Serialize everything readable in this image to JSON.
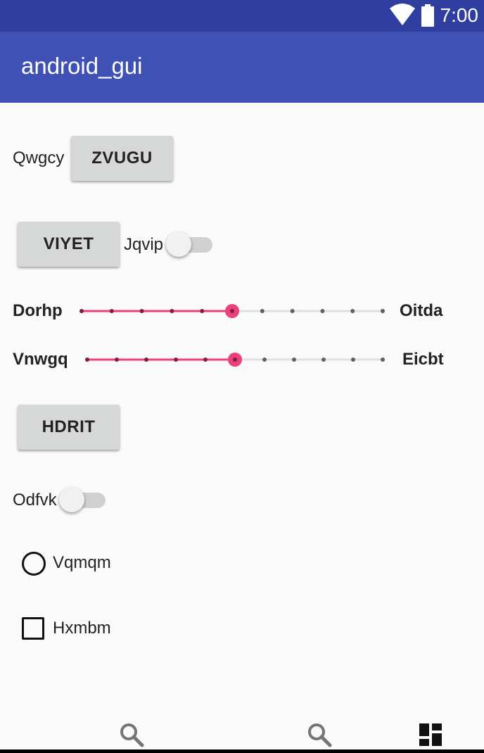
{
  "status_bar": {
    "time": "7:00",
    "icons": [
      "wifi-icon",
      "battery-icon"
    ]
  },
  "app_bar": {
    "title": "android_gui"
  },
  "row1": {
    "label": "Qwgcy",
    "button": "ZVUGU"
  },
  "row2": {
    "button": "VIYET",
    "switch_label": "Jqvip",
    "switch_on": false
  },
  "seekbar1": {
    "left_label": "Dorhp",
    "right_label": "Oitda",
    "steps": 10,
    "value": 5
  },
  "seekbar2": {
    "left_label": "Vnwgq",
    "right_label": "Eicbt",
    "steps": 10,
    "value": 5
  },
  "row3": {
    "button": "HDRIT"
  },
  "row4": {
    "switch_label": "Odfvk",
    "switch_on": false
  },
  "radio": {
    "label": "Vqmqm",
    "checked": false
  },
  "checkbox": {
    "label": "Hxmbm",
    "checked": false
  },
  "bottom_icons": [
    "search-icon",
    "search-icon",
    "dashboard-icon"
  ],
  "colors": {
    "primary": "#3f51b5",
    "primary_dark": "#303f9f",
    "accent": "#ec407a"
  }
}
